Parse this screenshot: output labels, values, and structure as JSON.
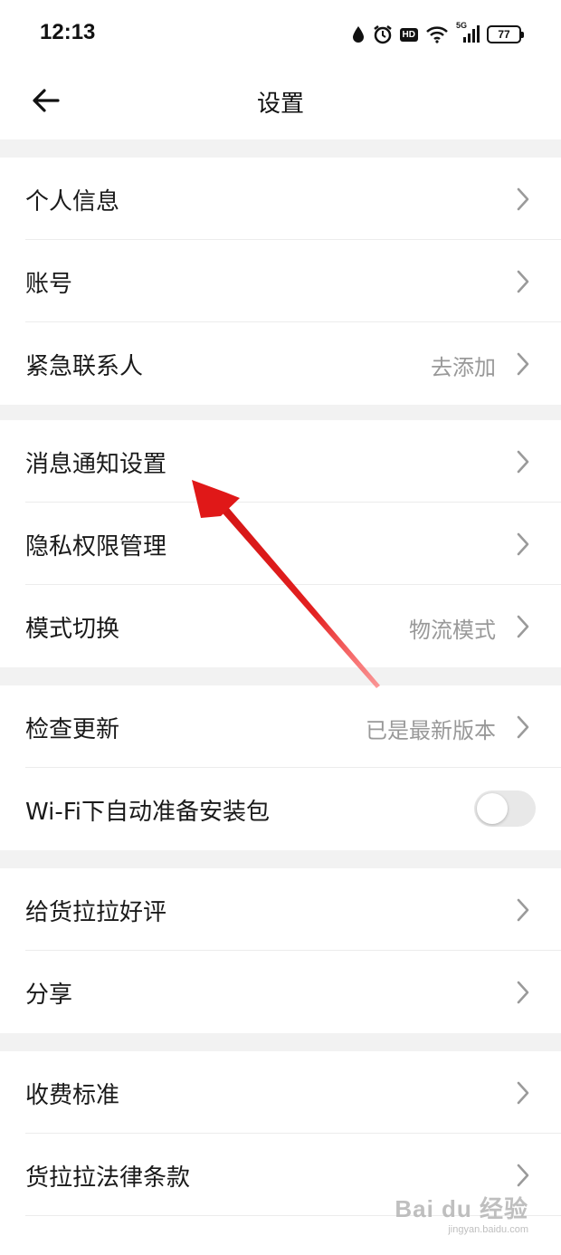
{
  "status_bar": {
    "time": "12:13",
    "hd_label": "HD",
    "network_label": "5G",
    "battery": "77"
  },
  "header": {
    "title": "设置"
  },
  "groups": [
    {
      "rows": [
        {
          "label": "个人信息",
          "value": ""
        },
        {
          "label": "账号",
          "value": ""
        },
        {
          "label": "紧急联系人",
          "value": "去添加"
        }
      ]
    },
    {
      "rows": [
        {
          "label": "消息通知设置",
          "value": ""
        },
        {
          "label": "隐私权限管理",
          "value": ""
        },
        {
          "label": "模式切换",
          "value": "物流模式"
        }
      ]
    },
    {
      "rows": [
        {
          "label": "检查更新",
          "value": "已是最新版本"
        },
        {
          "label": "Wi-Fi下自动准备安装包",
          "toggle": false
        }
      ]
    },
    {
      "rows": [
        {
          "label": "给货拉拉好评",
          "value": ""
        },
        {
          "label": "分享",
          "value": ""
        }
      ]
    },
    {
      "rows": [
        {
          "label": "收费标准",
          "value": ""
        },
        {
          "label": "货拉拉法律条款",
          "value": ""
        }
      ]
    }
  ],
  "annotation": {
    "arrow_color": "#e32020",
    "points_to": "消息通知设置"
  },
  "watermark": {
    "main": "Bai du 经验",
    "sub": "jingyan.baidu.com"
  }
}
